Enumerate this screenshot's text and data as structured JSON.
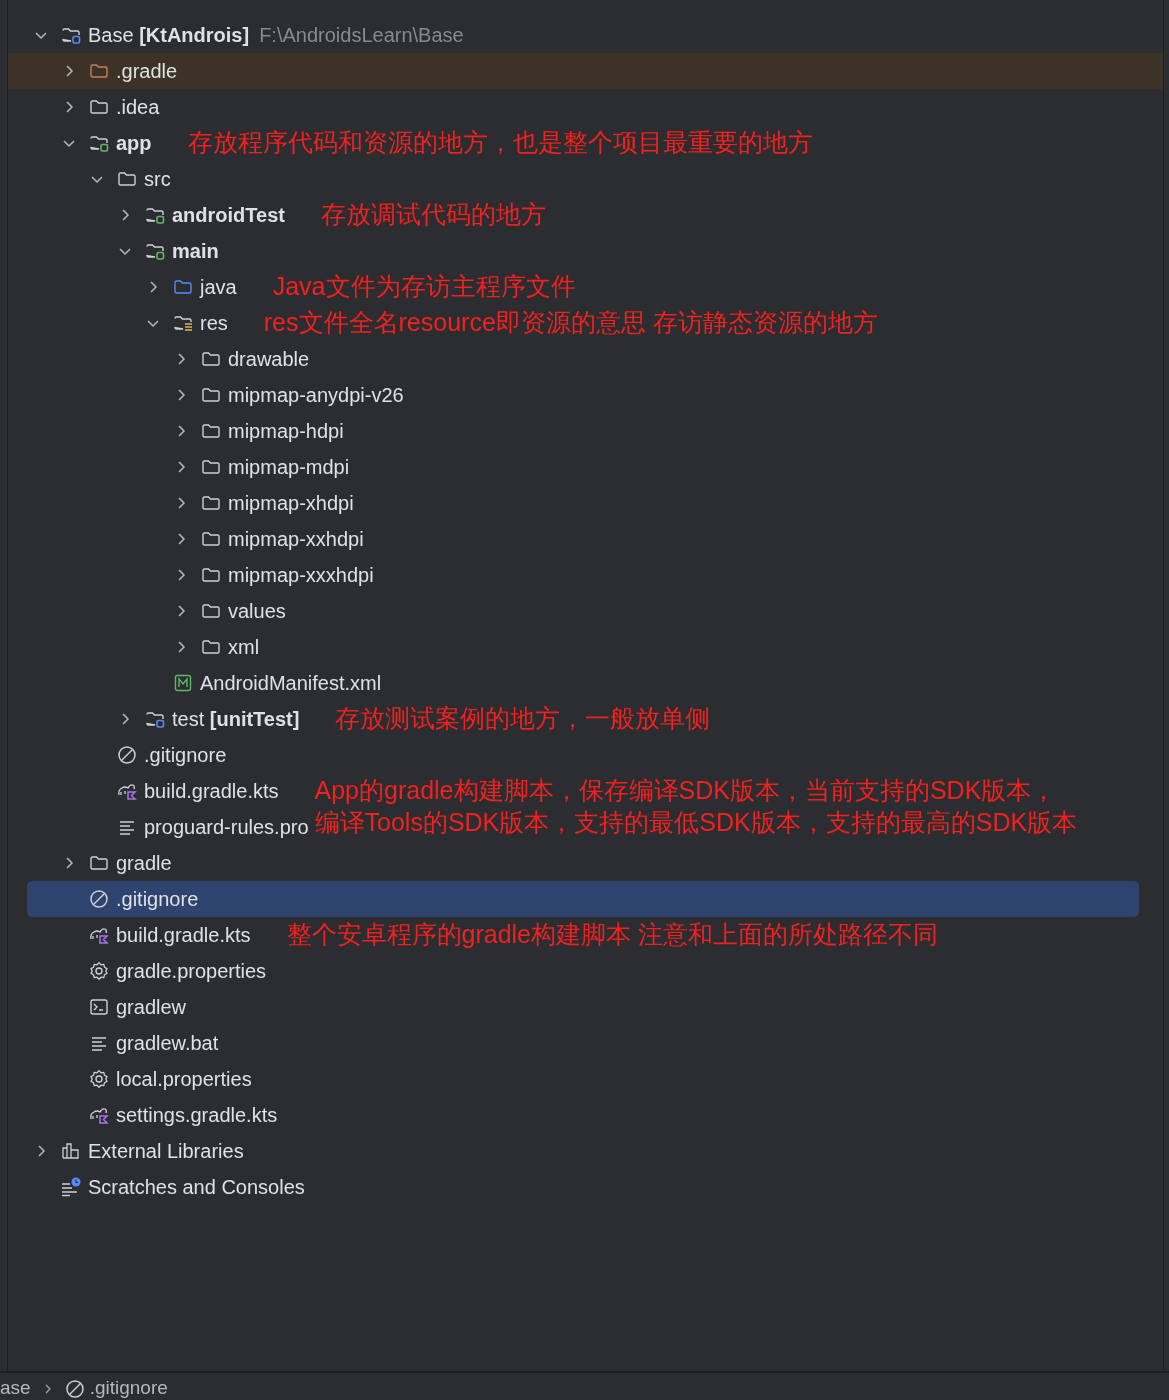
{
  "tree": [
    {
      "label": "Base **[KtAndrois]**",
      "path": "F:\\AndroidsLearn\\Base",
      "kind": "module_root",
      "expanded": true,
      "selected": false,
      "children": [
        {
          "label": ".gradle",
          "kind": "excluded",
          "expanded": false,
          "selected": false
        },
        {
          "label": ".idea",
          "kind": "folder",
          "expanded": false,
          "selected": false
        },
        {
          "label": "app",
          "bold": true,
          "kind": "module",
          "expanded": true,
          "selected": false,
          "note": [
            "存放程序代码和资源的地方，也是整个项目最重要的地方"
          ],
          "children": [
            {
              "label": "src",
              "kind": "folder",
              "expanded": true,
              "selected": false,
              "children": [
                {
                  "label": "androidTest",
                  "bold": true,
                  "kind": "module",
                  "expanded": false,
                  "selected": false,
                  "note": [
                    "存放调试代码的地方"
                  ]
                },
                {
                  "label": "main",
                  "bold": true,
                  "kind": "module",
                  "expanded": true,
                  "selected": false,
                  "children": [
                    {
                      "label": "java",
                      "kind": "source",
                      "expanded": false,
                      "selected": false,
                      "note": [
                        "Java文件为存访主程序文件"
                      ]
                    },
                    {
                      "label": "res",
                      "kind": "resources",
                      "expanded": true,
                      "selected": false,
                      "note": [
                        "res文件全名resource即资源的意思 存访静态资源的地方"
                      ],
                      "children": [
                        {
                          "label": "drawable",
                          "kind": "folder",
                          "expanded": false,
                          "selected": false
                        },
                        {
                          "label": "mipmap-anydpi-v26",
                          "kind": "folder",
                          "expanded": false,
                          "selected": false
                        },
                        {
                          "label": "mipmap-hdpi",
                          "kind": "folder",
                          "expanded": false,
                          "selected": false
                        },
                        {
                          "label": "mipmap-mdpi",
                          "kind": "folder",
                          "expanded": false,
                          "selected": false
                        },
                        {
                          "label": "mipmap-xhdpi",
                          "kind": "folder",
                          "expanded": false,
                          "selected": false
                        },
                        {
                          "label": "mipmap-xxhdpi",
                          "kind": "folder",
                          "expanded": false,
                          "selected": false
                        },
                        {
                          "label": "mipmap-xxxhdpi",
                          "kind": "folder",
                          "expanded": false,
                          "selected": false
                        },
                        {
                          "label": "values",
                          "kind": "folder",
                          "expanded": false,
                          "selected": false
                        },
                        {
                          "label": "xml",
                          "kind": "folder",
                          "expanded": false,
                          "selected": false
                        }
                      ]
                    },
                    {
                      "label": "AndroidManifest.xml",
                      "kind": "manifest",
                      "selected": false
                    }
                  ]
                },
                {
                  "label": "test **[unitTest]**",
                  "kind": "module_root",
                  "expanded": false,
                  "selected": false,
                  "note": [
                    "存放测试案例的地方，一般放单侧"
                  ]
                }
              ]
            },
            {
              "label": ".gitignore",
              "kind": "gitignore",
              "selected": false
            },
            {
              "label": "build.gradle.kts",
              "kind": "gradle_kts",
              "selected": false,
              "note": [
                "App的gradle构建脚本，保存编译SDK版本，当前支持的SDK版本，",
                "编译Tools的SDK版本，支持的最低SDK版本，支持的最高的SDK版本"
              ]
            },
            {
              "label": "proguard-rules.pro",
              "kind": "text",
              "selected": false
            }
          ]
        },
        {
          "label": "gradle",
          "kind": "folder",
          "expanded": false,
          "selected": false
        },
        {
          "label": ".gitignore",
          "kind": "gitignore",
          "selected": true
        },
        {
          "label": "build.gradle.kts",
          "kind": "gradle_kts",
          "selected": false,
          "note": [
            "整个安卓程序的gradle构建脚本 注意和上面的所处路径不同"
          ]
        },
        {
          "label": "gradle.properties",
          "kind": "properties",
          "selected": false
        },
        {
          "label": "gradlew",
          "kind": "terminal",
          "selected": false
        },
        {
          "label": "gradlew.bat",
          "kind": "text",
          "selected": false
        },
        {
          "label": "local.properties",
          "kind": "properties",
          "selected": false
        },
        {
          "label": "settings.gradle.kts",
          "kind": "gradle_kts",
          "selected": false
        }
      ]
    },
    {
      "label": "External Libraries",
      "kind": "libraries",
      "expanded": false,
      "selected": false
    },
    {
      "label": "Scratches and Consoles",
      "kind": "scratches",
      "selected": false
    }
  ],
  "breadcrumb": [
    {
      "label": "ase",
      "kind": "none"
    },
    {
      "label": ".gitignore",
      "kind": "gitignore"
    }
  ]
}
